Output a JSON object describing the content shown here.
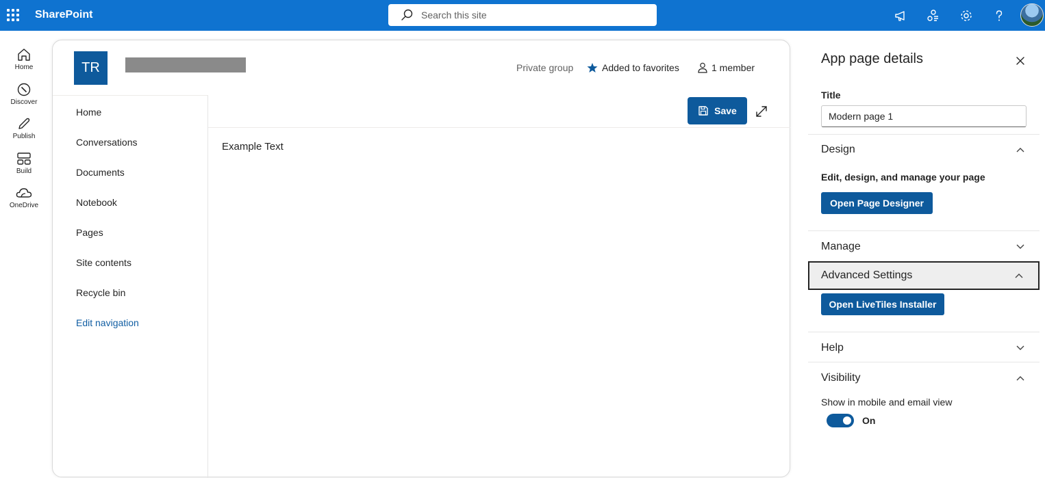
{
  "suitebar": {
    "brand": "SharePoint",
    "search_placeholder": "Search this site",
    "icons": [
      "megaphone-icon",
      "share-icon",
      "settings-gear-icon",
      "help-icon"
    ],
    "accent": "#0f73d0"
  },
  "appbar": {
    "items": [
      {
        "label": "Home",
        "icon": "home-icon"
      },
      {
        "label": "Discover",
        "icon": "compass-icon"
      },
      {
        "label": "Publish",
        "icon": "pencil-icon"
      },
      {
        "label": "Build",
        "icon": "build-icon"
      },
      {
        "label": "OneDrive",
        "icon": "cloud-icon"
      }
    ]
  },
  "site": {
    "logo_initials": "TR",
    "privacy": "Private group",
    "favorite_label": "Added to favorites",
    "members_label": "1 member",
    "nav": [
      "Home",
      "Conversations",
      "Documents",
      "Notebook",
      "Pages",
      "Site contents",
      "Recycle bin"
    ],
    "edit_nav": "Edit navigation",
    "save_label": "Save",
    "canvas_text": "Example Text"
  },
  "panel": {
    "title": "App page details",
    "title_field_label": "Title",
    "title_field_value": "Modern page 1",
    "design": {
      "label": "Design",
      "description": "Edit, design, and manage your page",
      "button": "Open Page Designer"
    },
    "manage": {
      "label": "Manage"
    },
    "advanced": {
      "label": "Advanced Settings",
      "button": "Open LiveTiles Installer"
    },
    "help": {
      "label": "Help"
    },
    "visibility": {
      "label": "Visibility",
      "description": "Show in mobile and email view",
      "toggle_state": "On"
    }
  }
}
